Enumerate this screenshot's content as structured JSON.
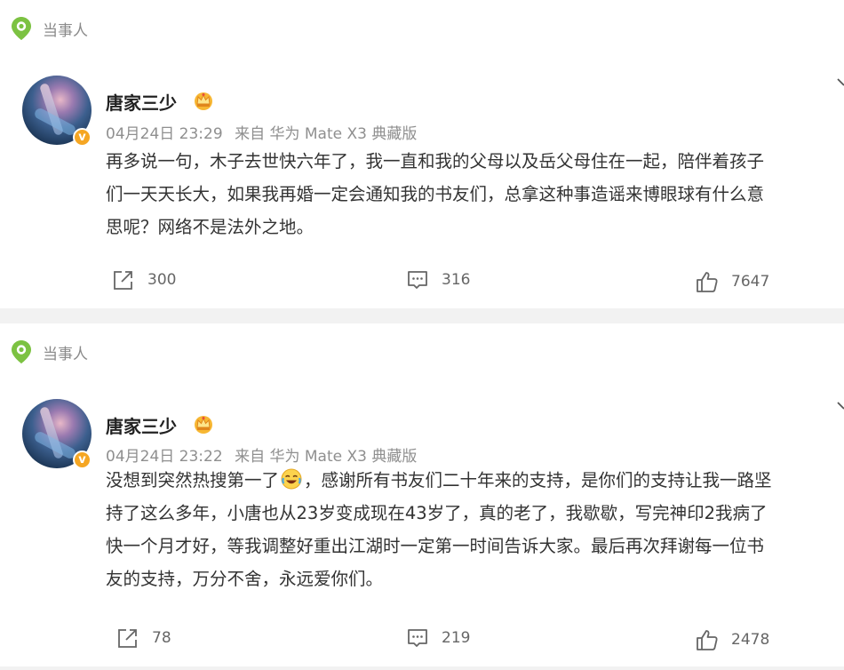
{
  "tag_label": "当事人",
  "posts": [
    {
      "username": "唐家三少",
      "timestamp": "04月24日 23:29",
      "source": "来自 华为 Mate X3 典藏版",
      "lines": [
        "再多说一句，木子去世快六年了，我一直和我的父母以及岳父母住在一起，陪伴着孩子",
        "们一天天长大，如果我再婚一定会通知我的书友们，总拿这种事造谣来博眼球有什么意",
        "思呢？网络不是法外之地。"
      ],
      "shares": "300",
      "comments": "316",
      "likes": "7647"
    },
    {
      "username": "唐家三少",
      "timestamp": "04月24日 23:22",
      "source": "来自 华为 Mate X3 典藏版",
      "line1_before_emoji": "没想到突然热搜第一了",
      "line1_after_emoji": "，感谢所有书友们二十年来的支持，是你们的支持让我一路坚",
      "lines": [
        "持了这么多年，小唐也从23岁变成现在43岁了，真的老了，我歇歇，写完神印2我病了",
        "快一个月才好，等我调整好重出江湖时一定第一时间告诉大家。最后再次拜谢每一位书",
        "友的支持，万分不舍，永远爱你们。"
      ],
      "shares": "78",
      "comments": "219",
      "likes": "2478"
    }
  ],
  "icons": {
    "tag": "location-pin-icon",
    "verified": "verified-badge-icon",
    "membership": "crown-icon",
    "share": "share-icon",
    "comment": "comment-icon",
    "like": "thumbs-up-icon",
    "menu": "chevron-down-icon",
    "emoji": "crying-laughing-emoji"
  },
  "colors": {
    "tag_green": "#7cc242",
    "verified_orange": "#f5a623",
    "separator": "#f2f2f2"
  },
  "verified_mark": "v"
}
